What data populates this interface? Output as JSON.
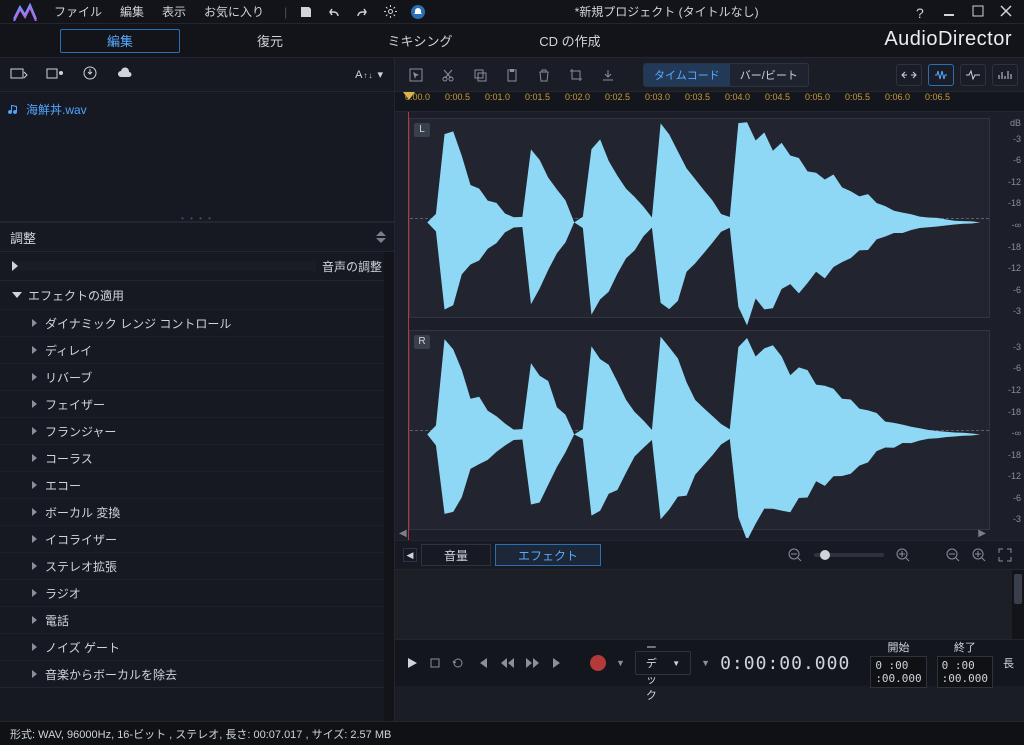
{
  "window": {
    "title": "*新規プロジェクト (タイトルなし)"
  },
  "brand": "AudioDirector",
  "menu": {
    "file": "ファイル",
    "edit": "編集",
    "view": "表示",
    "fav": "お気に入り"
  },
  "maintabs": {
    "edit": "編集",
    "restore": "復元",
    "mix": "ミキシング",
    "cd": "CD の作成"
  },
  "media": {
    "sort": "A↑↓",
    "file": "海鮮丼.wav"
  },
  "adjust": {
    "title": "調整",
    "sound": "音声の調整",
    "apply_fx": "エフェクトの適用",
    "fx": [
      "ダイナミック レンジ コントロール",
      "ディレイ",
      "リバーブ",
      "フェイザー",
      "フランジャー",
      "コーラス",
      "エコー",
      "ボーカル 変換",
      "イコライザー",
      "ステレオ拡張",
      "ラジオ",
      "電話",
      "ノイズ ゲート",
      "音楽からボーカルを除去"
    ]
  },
  "toolbar_right": {
    "timecode": "タイムコード",
    "barbeat": "バー/ビート"
  },
  "ruler": [
    "0:00.0",
    "0:00.5",
    "0:01.0",
    "0:01.5",
    "0:02.0",
    "0:02.5",
    "0:03.0",
    "0:03.5",
    "0:04.0",
    "0:04.5",
    "0:05.0",
    "0:05.5",
    "0:06.0",
    "0:06.5"
  ],
  "channels": {
    "left": "L",
    "right": "R",
    "db_header": "dB",
    "db": [
      "-3",
      "-6",
      "-12",
      "-18",
      "-∞",
      "-18",
      "-12",
      "-6",
      "-3"
    ]
  },
  "lower_tabs": {
    "volume": "音量",
    "effect": "エフェクト"
  },
  "transport": {
    "codec": "コーデック",
    "time": "0:00:00.000",
    "start_label": "開始",
    "start_val": "0 :00 :00.000",
    "end_label": "終了",
    "end_val": "0 :00 :00.000",
    "far_label": "長"
  },
  "status": "形式: WAV,  96000Hz,  16-ビット , ステレオ, 長さ:  00:07.017 , サイズ: 2.57 MB"
}
